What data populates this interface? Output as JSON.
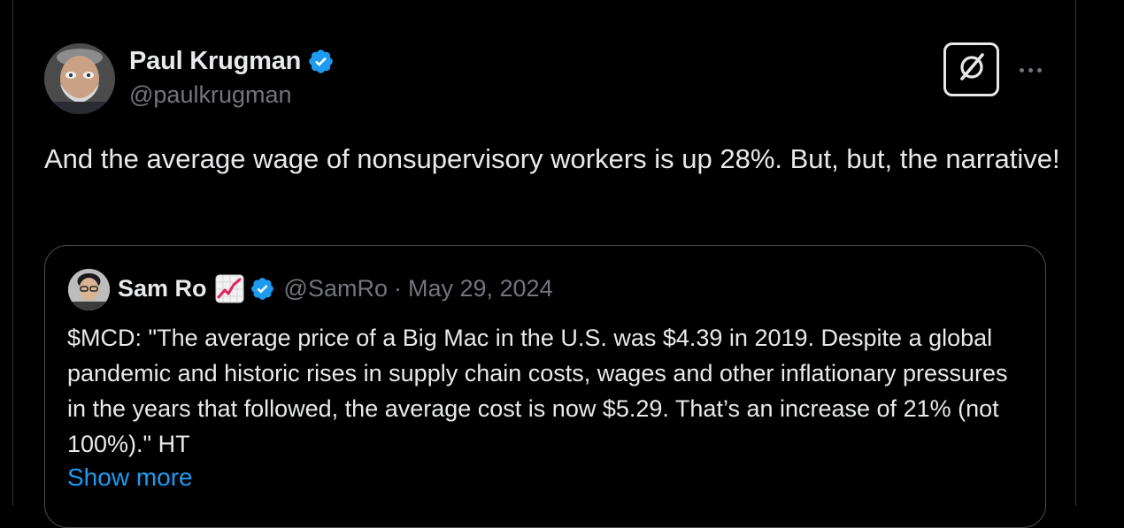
{
  "tweet": {
    "author": {
      "display_name": "Paul Krugman",
      "handle": "@paulkrugman",
      "verified": true
    },
    "text": "And the average wage of nonsupervisory workers is up 28%. But, but, the narrative!",
    "actions": {
      "grok_icon": "grok-icon",
      "more_icon": "more-icon"
    },
    "quote": {
      "author": {
        "display_name": "Sam Ro",
        "emoji": "chart-increasing-emoji",
        "handle": "@SamRo",
        "separator": "·",
        "date": "May 29, 2024",
        "verified": true
      },
      "text": "$MCD: \"The average price of a Big Mac in the U.S. was $4.39 in 2019. Despite a global pandemic and historic rises in supply chain costs, wages and other inflationary pressures in the years that followed, the average cost is now $5.29. That’s an increase of 21% (not 100%).\" HT",
      "show_more_label": "Show more"
    }
  },
  "colors": {
    "background": "#000000",
    "text_primary": "#e7e9ea",
    "text_secondary": "#71767b",
    "link": "#1d9bf0",
    "verified_badge": "#1d9bf0",
    "border": "#2f3336"
  }
}
